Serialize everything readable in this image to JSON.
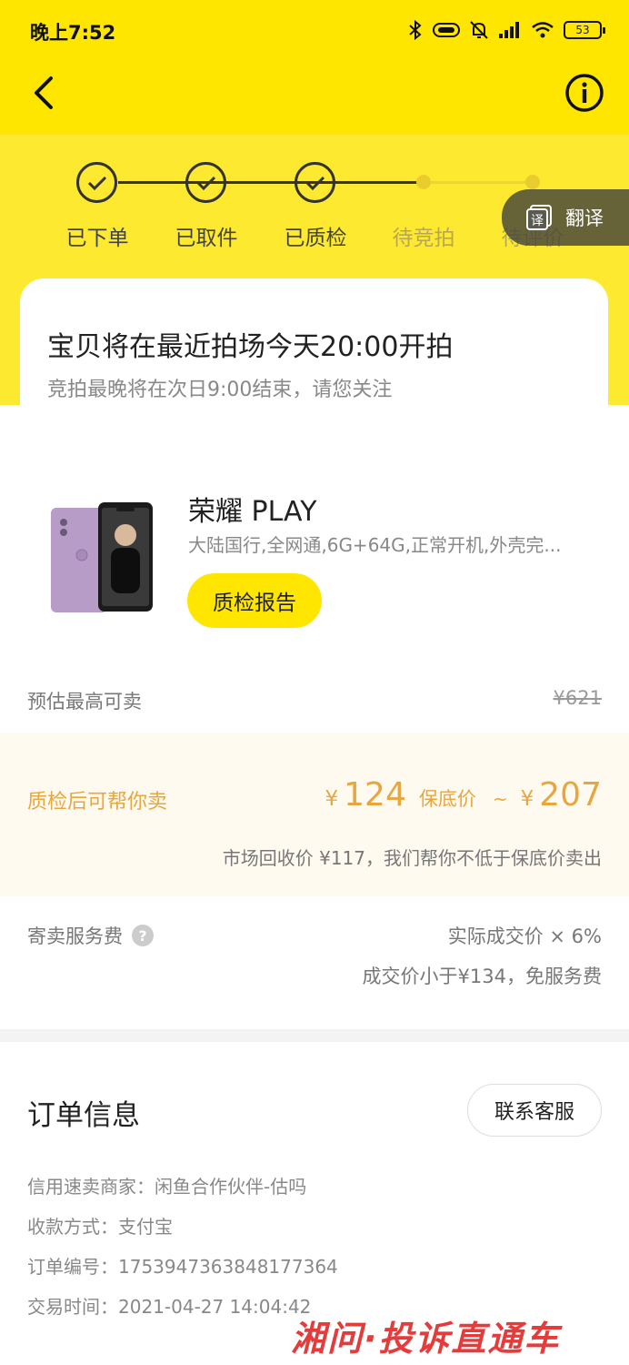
{
  "status_bar": {
    "time": "晚上7:52",
    "battery": "53"
  },
  "steps": [
    {
      "label": "已下单",
      "done": true
    },
    {
      "label": "已取件",
      "done": true
    },
    {
      "label": "已质检",
      "done": true
    },
    {
      "label": "待竞拍",
      "done": false
    },
    {
      "label": "待评价",
      "done": false
    }
  ],
  "translate": {
    "label": "翻译"
  },
  "notice": {
    "headline": "宝贝将在最近拍场今天20:00开拍",
    "sub": "竞拍最晚将在次日9:00结束，请您关注"
  },
  "product": {
    "title": "荣耀 PLAY",
    "desc": "大陆国行,全网通,6G+64G,正常开机,外壳完...",
    "report_button": "质检报告"
  },
  "estimate": {
    "label": "预估最高可卖",
    "value": "¥621"
  },
  "sell_help": {
    "label": "质检后可帮你卖",
    "yen": "¥",
    "low": "124",
    "floor_label": "保底价",
    "tilde": "~",
    "high": "207",
    "note": "市场回收价 ¥117，我们帮你不低于保底价卖出"
  },
  "fee": {
    "label": "寄卖服务费",
    "rate": "实际成交价 × 6%",
    "free_note": "成交价小于¥134，免服务费"
  },
  "order": {
    "title": "订单信息",
    "contact_button": "联系客服",
    "rows": [
      "信用速卖商家：闲鱼合作伙伴-估吗",
      "收款方式：支付宝",
      "订单编号：1753947363848177364",
      "交易时间：2021-04-27 14:04:42"
    ]
  },
  "watermark": "湘问·投诉直通车",
  "colors": {
    "accent": "#ffe600",
    "price": "#e8a640"
  }
}
